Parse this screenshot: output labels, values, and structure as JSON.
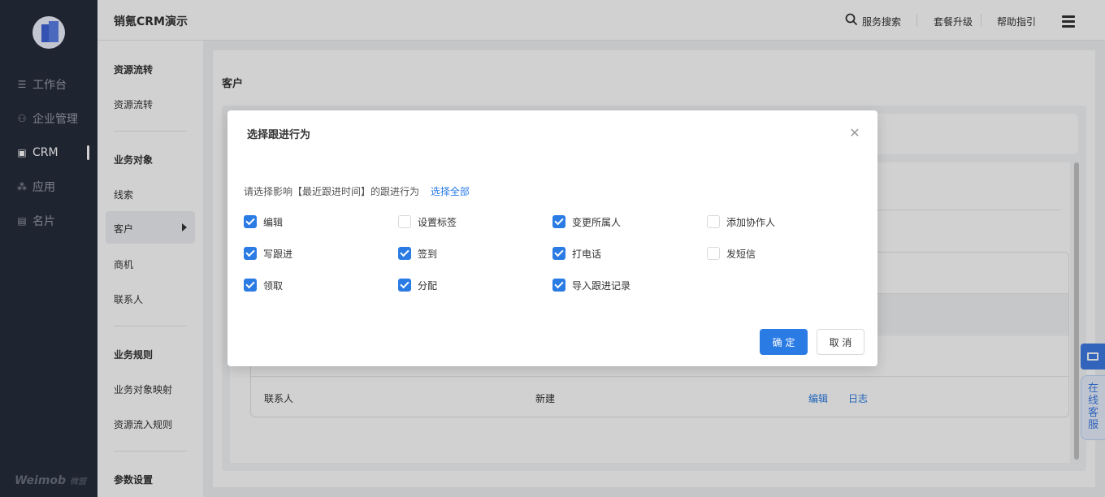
{
  "app": {
    "title": "销氪CRM演示"
  },
  "header": {
    "search": "服务搜索",
    "upgrade": "套餐升级",
    "help": "帮助指引"
  },
  "nav": {
    "items": [
      {
        "label": "工作台",
        "icon": "workbench-icon"
      },
      {
        "label": "企业管理",
        "icon": "org-chart-icon"
      },
      {
        "label": "CRM",
        "icon": "crm-icon"
      },
      {
        "label": "应用",
        "icon": "apps-grid-icon"
      },
      {
        "label": "名片",
        "icon": "business-card-icon"
      }
    ],
    "footer_brand": "Weimob",
    "footer_sub": "微盟"
  },
  "subnav": {
    "group1_head": "资源流转",
    "group1_item": "资源流转",
    "group2_head": "业务对象",
    "items2": [
      "线索",
      "客户",
      "商机",
      "联系人"
    ],
    "group3_head": "业务规则",
    "items3": [
      "业务对象映射",
      "资源流入规则"
    ],
    "group4_head": "参数设置"
  },
  "main": {
    "title": "客户",
    "table_last_row": {
      "name": "联系人",
      "action": "新建",
      "edit": "编辑",
      "log": "日志"
    }
  },
  "service": {
    "label": "在线客服"
  },
  "dialog": {
    "title": "选择跟进行为",
    "hint": "请选择影响【最近跟进时间】的跟进行为",
    "select_all": "选择全部",
    "options": [
      {
        "label": "编辑",
        "checked": true
      },
      {
        "label": "设置标签",
        "checked": false
      },
      {
        "label": "变更所属人",
        "checked": true
      },
      {
        "label": "添加协作人",
        "checked": false
      },
      {
        "label": "写跟进",
        "checked": true
      },
      {
        "label": "签到",
        "checked": true
      },
      {
        "label": "打电话",
        "checked": true
      },
      {
        "label": "发短信",
        "checked": false
      },
      {
        "label": "领取",
        "checked": true
      },
      {
        "label": "分配",
        "checked": true
      },
      {
        "label": "导入跟进记录",
        "checked": true
      }
    ],
    "confirm": "确 定",
    "cancel": "取 消"
  },
  "colors": {
    "accent": "#2a7be4",
    "sidebar": "#262c3c"
  }
}
